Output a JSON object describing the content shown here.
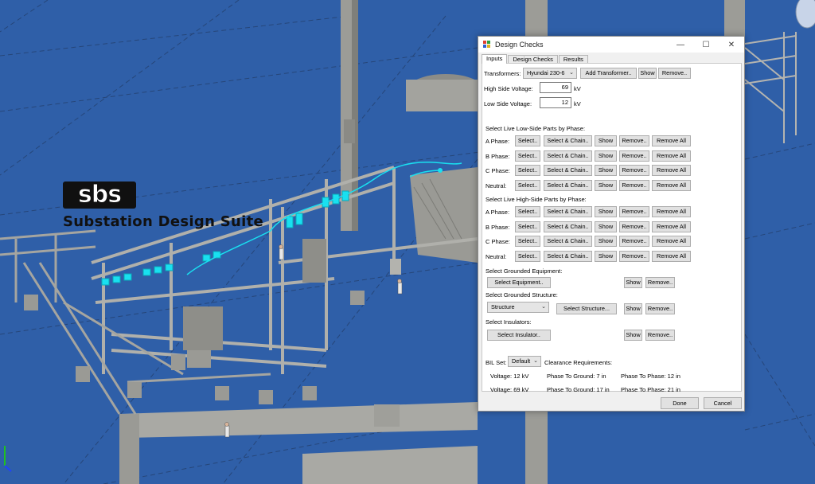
{
  "logo": {
    "mark": "sbs",
    "subtitle": "Substation Design Suite"
  },
  "dialog": {
    "title": "Design Checks",
    "tabs": [
      "Inputs",
      "Design Checks",
      "Results"
    ],
    "transformers": {
      "label": "Transformers:",
      "selected": "Hyundai 230-6",
      "add": "Add Transformer..",
      "show": "Show",
      "remove": "Remove.."
    },
    "high_side": {
      "label": "High Side Voltage:",
      "value": "69",
      "unit": "kV"
    },
    "low_side": {
      "label": "Low Side Voltage:",
      "value": "12",
      "unit": "kV"
    },
    "low_parts": {
      "heading": "Select Live Low-Side Parts by Phase:",
      "rows": [
        {
          "label": "A Phase:"
        },
        {
          "label": "B Phase:"
        },
        {
          "label": "C Phase:"
        },
        {
          "label": "Neutral:"
        }
      ]
    },
    "high_parts": {
      "heading": "Select Live High-Side Parts by Phase:",
      "rows": [
        {
          "label": "A Phase:"
        },
        {
          "label": "B Phase:"
        },
        {
          "label": "C Phase:"
        },
        {
          "label": "Neutral:"
        }
      ]
    },
    "row_buttons": {
      "select": "Select..",
      "chain": "Select & Chain..",
      "show": "Show",
      "remove": "Remove..",
      "remove_all": "Remove All"
    },
    "grounded_equipment": {
      "heading": "Select Grounded Equipment:",
      "button": "Select Equipment..",
      "show": "Show",
      "remove": "Remove.."
    },
    "grounded_structure": {
      "heading": "Select Grounded Structure:",
      "combo": "Structure",
      "button": "Select Structure...",
      "show": "Show",
      "remove": "Remove.."
    },
    "insulators": {
      "heading": "Select Insulators:",
      "button": "Select Insulator..",
      "show": "Show",
      "remove": "Remove.."
    },
    "bil": {
      "label": "BIL Set:",
      "value": "Default",
      "clearance": "Clearance Requirements:"
    },
    "requirements": [
      {
        "voltage": "Voltage: 12 kV",
        "ground": "Phase To Ground: 7 in",
        "phase": "Phase To Phase: 12 in"
      },
      {
        "voltage": "Voltage: 69 kV",
        "ground": "Phase To Ground: 17 in",
        "phase": "Phase To Phase: 21 in"
      }
    ],
    "done": "Done",
    "cancel": "Cancel"
  },
  "colors": {
    "sky": "#2f5fa8",
    "steel": "#a9a9a4",
    "highlight": "#19e0f0"
  }
}
